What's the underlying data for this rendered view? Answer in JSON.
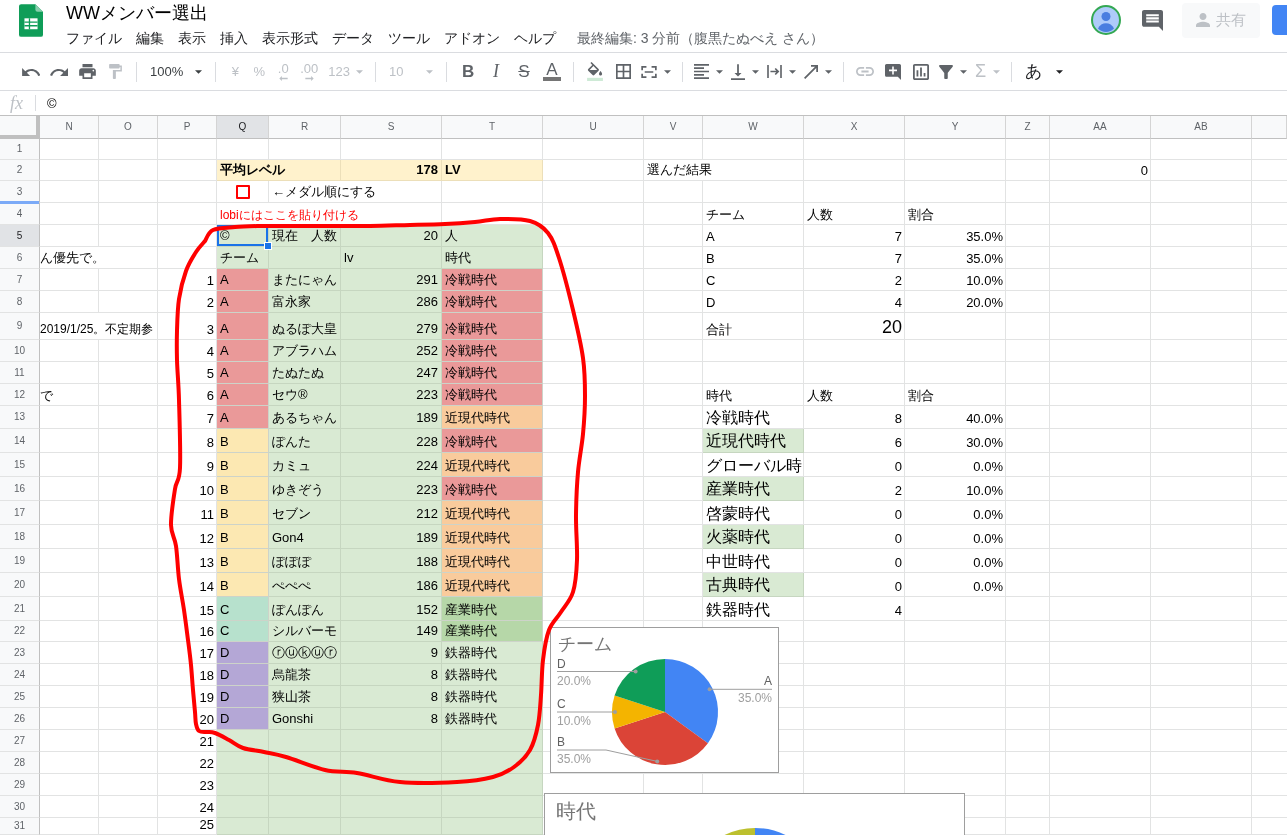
{
  "document": {
    "title": "WWメンバー選出",
    "menu": [
      "ファイル",
      "編集",
      "表示",
      "挿入",
      "表示形式",
      "データ",
      "ツール",
      "アドオン",
      "ヘルプ"
    ],
    "last_edit": "最終編集: 3 分前（腹黒たぬべえ さん）",
    "share": {
      "label": "共有",
      "disabled": true
    }
  },
  "toolbar": [
    [
      {
        "disabled": false
      },
      {
        "disabled": false
      },
      {
        "disabled": false
      },
      {
        "disabled": true
      }
    ],
    [
      {
        "label": "100%",
        "disabled": false
      }
    ],
    [
      {
        "label": "¥",
        "disabled": true
      },
      {
        "label": "%",
        "disabled": true
      },
      {
        "label": ".0",
        "disabled": true
      },
      {
        "label": ".00",
        "disabled": true
      },
      {
        "label": "123",
        "disabled": true
      }
    ],
    [
      {
        "label": "10",
        "disabled": true
      }
    ],
    [
      {
        "label": "B",
        "disabled": false
      },
      {
        "label": "I",
        "disabled": false
      },
      {
        "label": "S",
        "disabled": false
      },
      {
        "label": "A",
        "disabled": false
      }
    ],
    [
      {
        "disabled": false
      },
      {
        "disabled": false
      },
      {
        "disabled": false
      }
    ],
    [
      {
        "disabled": false
      },
      {
        "disabled": false
      },
      {
        "disabled": false
      },
      {
        "disabled": false
      }
    ],
    [
      {
        "disabled": true
      },
      {
        "disabled": false
      },
      {
        "disabled": false
      },
      {
        "disabled": false
      },
      {
        "label": "Σ",
        "disabled": true
      }
    ],
    [
      {
        "label": "あ",
        "disabled": false
      }
    ]
  ],
  "formula_bar": {
    "label": "fx",
    "value": "©"
  },
  "columns": [
    {
      "label": "N",
      "selected": false
    },
    {
      "label": "O",
      "selected": false
    },
    {
      "label": "P",
      "selected": false
    },
    {
      "label": "Q",
      "selected": true
    },
    {
      "label": "R",
      "selected": false
    },
    {
      "label": "S",
      "selected": false
    },
    {
      "label": "T",
      "selected": false
    },
    {
      "label": "U",
      "selected": false
    },
    {
      "label": "V",
      "selected": false
    },
    {
      "label": "W",
      "selected": false
    },
    {
      "label": "X",
      "selected": false
    },
    {
      "label": "Y",
      "selected": false
    },
    {
      "label": "Z",
      "selected": false
    },
    {
      "label": "AA",
      "selected": false
    },
    {
      "label": "AB",
      "selected": false
    }
  ],
  "rows": [
    {
      "label": "1",
      "selected": false
    },
    {
      "label": "2",
      "selected": false
    },
    {
      "label": "3",
      "selected": false
    },
    {
      "label": "4",
      "selected": false
    },
    {
      "label": "5",
      "selected": true
    },
    {
      "label": "6",
      "selected": false
    },
    {
      "label": "7",
      "selected": false
    },
    {
      "label": "8",
      "selected": false
    },
    {
      "label": "9",
      "selected": false
    },
    {
      "label": "10",
      "selected": false
    },
    {
      "label": "11",
      "selected": false
    },
    {
      "label": "12",
      "selected": false
    },
    {
      "label": "13",
      "selected": false
    },
    {
      "label": "14",
      "selected": false
    },
    {
      "label": "15",
      "selected": false
    },
    {
      "label": "16",
      "selected": false
    },
    {
      "label": "17",
      "selected": false
    },
    {
      "label": "18",
      "selected": false
    },
    {
      "label": "19",
      "selected": false
    },
    {
      "label": "20",
      "selected": false
    },
    {
      "label": "21",
      "selected": false
    },
    {
      "label": "22",
      "selected": false
    },
    {
      "label": "23",
      "selected": false
    },
    {
      "label": "24",
      "selected": false
    },
    {
      "label": "25",
      "selected": false
    },
    {
      "label": "26",
      "selected": false
    },
    {
      "label": "27",
      "selected": false
    },
    {
      "label": "28",
      "selected": false
    },
    {
      "label": "29",
      "selected": false
    },
    {
      "label": "30",
      "selected": false
    },
    {
      "label": "31",
      "selected": false
    }
  ],
  "notes": [
    "ん優先で。",
    "2019/1/25。不定期参",
    "で"
  ],
  "average": {
    "label": "平均レベル",
    "value": "178",
    "unit": "LV"
  },
  "result": {
    "label": "選んだ結果",
    "value": "0"
  },
  "medal_sort": {
    "checked": false,
    "label": "←メダル順にする"
  },
  "paste_hint": "lobiにはここを貼り付ける",
  "current": {
    "mark": "©",
    "label": "現在　人数",
    "value": "20",
    "unit": "人"
  },
  "members": {
    "header": {
      "team": "チーム",
      "level": "lv",
      "era": "時代"
    },
    "rows": [
      {
        "no": "1",
        "team": {
          "text": "A",
          "color": "#ea9999"
        },
        "name": "またにゃん",
        "lv": "291",
        "era": {
          "text": "冷戦時代",
          "color": "#ea9999"
        }
      },
      {
        "no": "2",
        "team": {
          "text": "A",
          "color": "#ea9999"
        },
        "name": "富永家",
        "lv": "286",
        "era": {
          "text": "冷戦時代",
          "color": "#ea9999"
        }
      },
      {
        "no": "3",
        "team": {
          "text": "A",
          "color": "#ea9999"
        },
        "name": "ぬるぽ大皇",
        "lv": "279",
        "era": {
          "text": "冷戦時代",
          "color": "#ea9999"
        }
      },
      {
        "no": "4",
        "team": {
          "text": "A",
          "color": "#ea9999"
        },
        "name": "アブラハム",
        "lv": "252",
        "era": {
          "text": "冷戦時代",
          "color": "#ea9999"
        }
      },
      {
        "no": "5",
        "team": {
          "text": "A",
          "color": "#ea9999"
        },
        "name": "たぬたぬ",
        "lv": "247",
        "era": {
          "text": "冷戦時代",
          "color": "#ea9999"
        }
      },
      {
        "no": "6",
        "team": {
          "text": "A",
          "color": "#ea9999"
        },
        "name": "セウ®",
        "lv": "223",
        "era": {
          "text": "冷戦時代",
          "color": "#ea9999"
        }
      },
      {
        "no": "7",
        "team": {
          "text": "A",
          "color": "#ea9999"
        },
        "name": "あるちゃん",
        "lv": "189",
        "era": {
          "text": "近現代時代",
          "color": "#f9cb9c"
        }
      },
      {
        "no": "8",
        "team": {
          "text": "B",
          "color": "#fce8b2"
        },
        "name": "ぽんた",
        "lv": "228",
        "era": {
          "text": "冷戦時代",
          "color": "#ea9999"
        }
      },
      {
        "no": "9",
        "team": {
          "text": "B",
          "color": "#fce8b2"
        },
        "name": "カミュ",
        "lv": "224",
        "era": {
          "text": "近現代時代",
          "color": "#f9cb9c"
        }
      },
      {
        "no": "10",
        "team": {
          "text": "B",
          "color": "#fce8b2"
        },
        "name": "ゆきぞう",
        "lv": "223",
        "era": {
          "text": "冷戦時代",
          "color": "#ea9999"
        }
      },
      {
        "no": "11",
        "team": {
          "text": "B",
          "color": "#fce8b2"
        },
        "name": "セブン",
        "lv": "212",
        "era": {
          "text": "近現代時代",
          "color": "#f9cb9c"
        }
      },
      {
        "no": "12",
        "team": {
          "text": "B",
          "color": "#fce8b2"
        },
        "name": "Gon4",
        "lv": "189",
        "era": {
          "text": "近現代時代",
          "color": "#f9cb9c"
        }
      },
      {
        "no": "13",
        "team": {
          "text": "B",
          "color": "#fce8b2"
        },
        "name": "ぽぽぽ",
        "lv": "188",
        "era": {
          "text": "近現代時代",
          "color": "#f9cb9c"
        }
      },
      {
        "no": "14",
        "team": {
          "text": "B",
          "color": "#fce8b2"
        },
        "name": "ぺぺぺ",
        "lv": "186",
        "era": {
          "text": "近現代時代",
          "color": "#f9cb9c"
        }
      },
      {
        "no": "15",
        "team": {
          "text": "C",
          "color": "#b7e1cd"
        },
        "name": "ぽんぽん",
        "lv": "152",
        "era": {
          "text": "産業時代",
          "color": "#b6d7a8"
        }
      },
      {
        "no": "16",
        "team": {
          "text": "C",
          "color": "#b7e1cd"
        },
        "name": "シルバーモ",
        "lv": "149",
        "era": {
          "text": "産業時代",
          "color": "#b6d7a8"
        }
      },
      {
        "no": "17",
        "team": {
          "text": "D",
          "color": "#b4a7d6"
        },
        "name": "ⓡⓤⓚⓤⓡ",
        "lv": "9",
        "era": {
          "text": "鉄器時代"
        }
      },
      {
        "no": "18",
        "team": {
          "text": "D",
          "color": "#b4a7d6"
        },
        "name": "烏龍茶",
        "lv": "8",
        "era": {
          "text": "鉄器時代"
        }
      },
      {
        "no": "19",
        "team": {
          "text": "D",
          "color": "#b4a7d6"
        },
        "name": "狭山茶",
        "lv": "8",
        "era": {
          "text": "鉄器時代"
        }
      },
      {
        "no": "20",
        "team": {
          "text": "D",
          "color": "#b4a7d6"
        },
        "name": "Gonshi",
        "lv": "8",
        "era": {
          "text": "鉄器時代"
        }
      },
      {
        "no": "21"
      },
      {
        "no": "22"
      },
      {
        "no": "23"
      },
      {
        "no": "24"
      },
      {
        "no": "25"
      }
    ]
  },
  "team_summary": {
    "header": [
      "チーム",
      "人数",
      "割合"
    ],
    "rows": [
      {
        "team": "A",
        "count": "7",
        "share": "35.0%"
      },
      {
        "team": "B",
        "count": "7",
        "share": "35.0%"
      },
      {
        "team": "C",
        "count": "2",
        "share": "10.0%"
      },
      {
        "team": "D",
        "count": "4",
        "share": "20.0%"
      }
    ],
    "total": {
      "label": "合計",
      "value": "20"
    }
  },
  "era_summary": {
    "header": [
      "時代",
      "人数",
      "割合"
    ],
    "rows": [
      {
        "era": "冷戦時代",
        "count": "8",
        "share": "40.0%"
      },
      {
        "era": "近現代時代",
        "count": "6",
        "share": "30.0%"
      },
      {
        "era": "グローバル時",
        "count": "0",
        "share": "0.0%"
      },
      {
        "era": "産業時代",
        "count": "2",
        "share": "10.0%"
      },
      {
        "era": "啓蒙時代",
        "count": "0",
        "share": "0.0%"
      },
      {
        "era": "火薬時代",
        "count": "0",
        "share": "0.0%"
      },
      {
        "era": "中世時代",
        "count": "0",
        "share": "0.0%"
      },
      {
        "era": "古典時代",
        "count": "0",
        "share": "0.0%"
      },
      {
        "era": "鉄器時代",
        "count": "4"
      }
    ]
  },
  "team_chart": {
    "chart_data": {
      "type": "pie",
      "title": "チーム",
      "categories": [
        "A",
        "B",
        "C",
        "D"
      ],
      "values": [
        35,
        35,
        10,
        20
      ],
      "value_labels": [
        "35.0%",
        "35.0%",
        "10.0%",
        "20.0%"
      ]
    }
  },
  "era_chart": {
    "title": "時代"
  }
}
